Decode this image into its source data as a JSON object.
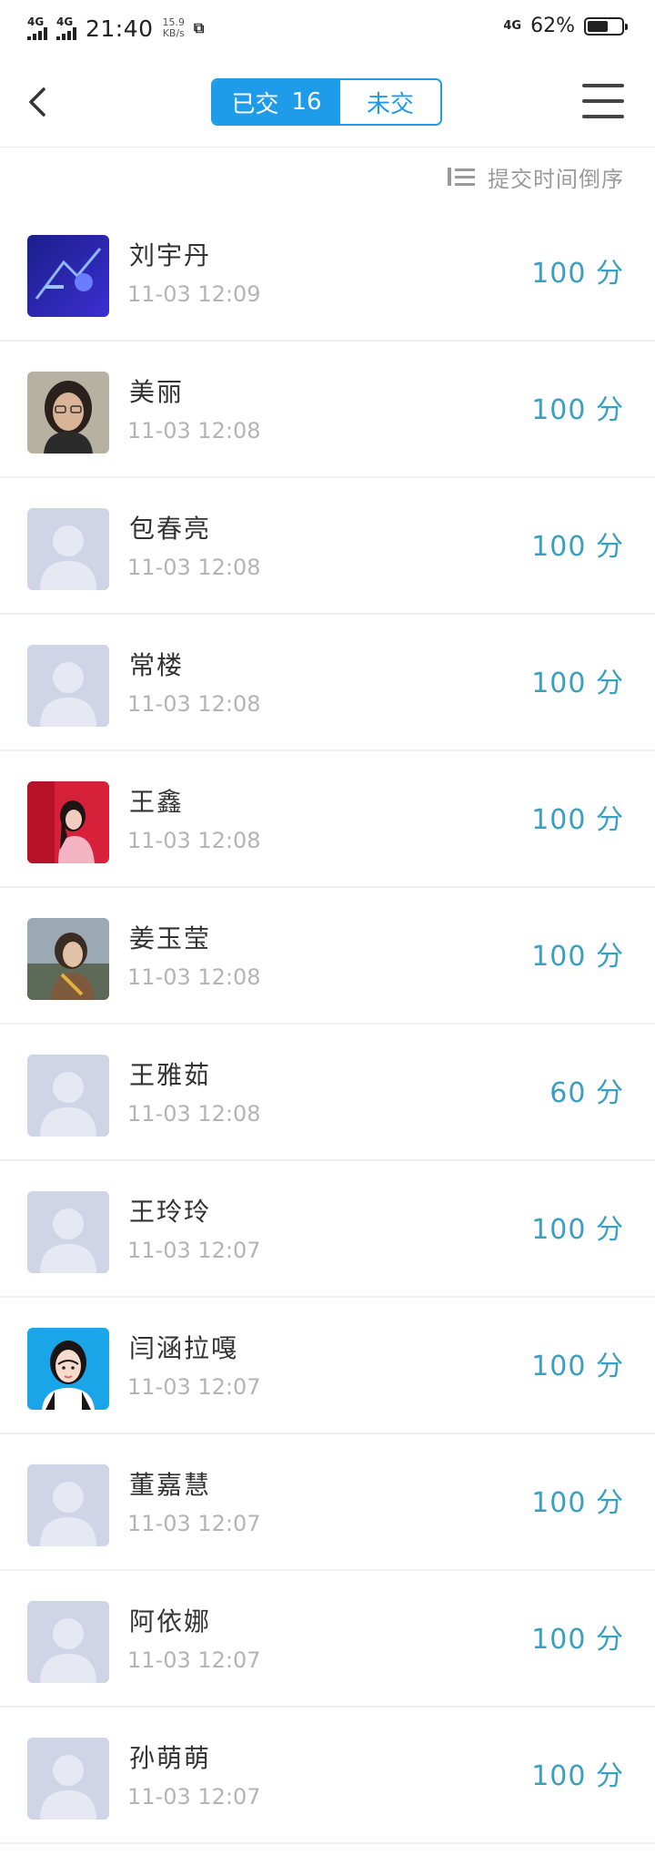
{
  "status_bar": {
    "signal_1": "4G",
    "signal_2": "4G",
    "time": "21:40",
    "speed_value": "15.9",
    "speed_unit": "KB/s",
    "network": "4G",
    "battery": "62%",
    "battery_level": 0.62
  },
  "nav": {
    "submitted_label": "已交",
    "submitted_count": "16",
    "not_submitted_label": "未交",
    "accent_color": "#1e9be9"
  },
  "sort": {
    "label": "提交时间倒序",
    "icon": "sort-list-icon"
  },
  "students": [
    {
      "name": "刘宇丹",
      "time": "11-03 12:09",
      "score": "100 分",
      "avatar": "photo-blue"
    },
    {
      "name": "美丽",
      "time": "11-03 12:08",
      "score": "100 分",
      "avatar": "photo-portrait-glasses"
    },
    {
      "name": "包春亮",
      "time": "11-03 12:08",
      "score": "100 分",
      "avatar": "default-avatar"
    },
    {
      "name": "常楼",
      "time": "11-03 12:08",
      "score": "100 分",
      "avatar": "default-avatar"
    },
    {
      "name": "王鑫",
      "time": "11-03 12:08",
      "score": "100 分",
      "avatar": "photo-red"
    },
    {
      "name": "姜玉莹",
      "time": "11-03 12:08",
      "score": "100 分",
      "avatar": "photo-outdoor"
    },
    {
      "name": "王雅茹",
      "time": "11-03 12:08",
      "score": "60 分",
      "avatar": "default-avatar"
    },
    {
      "name": "王玲玲",
      "time": "11-03 12:07",
      "score": "100 分",
      "avatar": "default-avatar"
    },
    {
      "name": "闫涵拉嘎",
      "time": "11-03 12:07",
      "score": "100 分",
      "avatar": "photo-id-blue"
    },
    {
      "name": "董嘉慧",
      "time": "11-03 12:07",
      "score": "100 分",
      "avatar": "default-avatar"
    },
    {
      "name": "阿依娜",
      "time": "11-03 12:07",
      "score": "100 分",
      "avatar": "default-avatar"
    },
    {
      "name": "孙萌萌",
      "time": "11-03 12:07",
      "score": "100 分",
      "avatar": "default-avatar"
    }
  ]
}
